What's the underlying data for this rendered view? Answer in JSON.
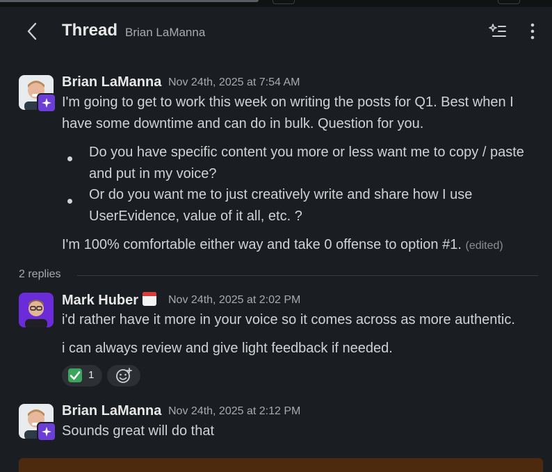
{
  "header": {
    "title": "Thread",
    "subtitle": "Brian LaManna"
  },
  "thread": {
    "parent": {
      "author": "Brian LaManna",
      "timestamp": "Nov 24th, 2025 at 7:54 AM",
      "line1": "I'm going to get to work this week on writing the posts for Q1. Best when I",
      "line2": "have some downtime and can do in bulk. Question for you.",
      "bullets": [
        {
          "line1": "Do you have specific content you more or less want me to copy / paste",
          "line2": "and put in my voice?"
        },
        {
          "line1": "Or do you want me to just creatively write and share how I use",
          "line2": "UserEvidence, value of it all, etc. ?"
        }
      ],
      "closing": "I'm 100% comfortable either way and take 0 offense to option #1.",
      "edited_label": "(edited)"
    },
    "replies_count": "2 replies",
    "replies": [
      {
        "author": "Mark Huber",
        "timestamp": "Nov 24th, 2025 at 2:02 PM",
        "line1": "i'd rather have it more in your voice so it comes across as more authentic.",
        "line2": "i can always review and give light feedback if needed.",
        "status_icon": "calendar-icon",
        "reaction": {
          "emoji": "white-check-mark",
          "emoji_glyph": "✓",
          "count": "1"
        }
      },
      {
        "author": "Brian LaManna",
        "timestamp": "Nov 24th, 2025 at 2:12 PM",
        "line1": "Sounds great will do that"
      }
    ]
  },
  "colors": {
    "background": "#1a1d21",
    "text": "#d1d2d3",
    "muted": "#a8aaad",
    "badge": "#6b3fd6",
    "mark_avatar_bg": "#6b2bd9",
    "reaction_green": "#3ba55d",
    "footer_bar": "#4d2a0e"
  },
  "icons": {
    "back": "chevron-left-icon",
    "ai": "sparkle-list-icon",
    "more": "vertical-dots-icon",
    "add_reaction": "add-emoji-icon"
  }
}
